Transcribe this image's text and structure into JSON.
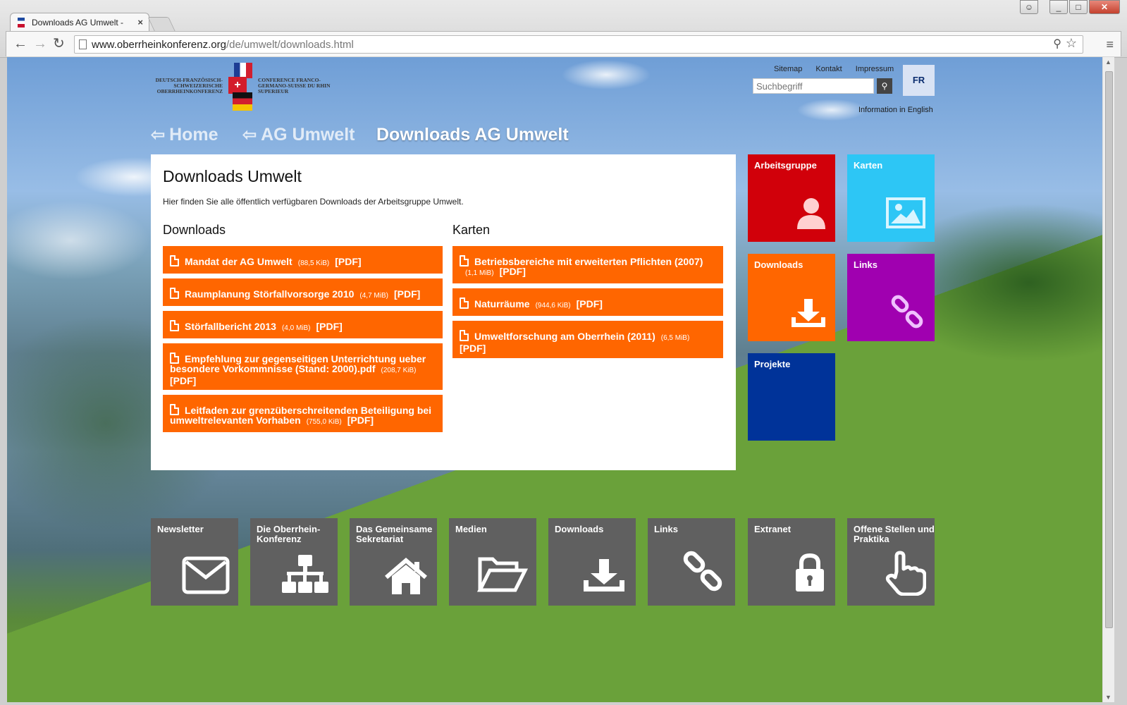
{
  "browser": {
    "tab_title": "Downloads AG Umwelt - ",
    "tab_close": "×",
    "url_host": "www.oberrheinkonferenz.org",
    "url_path": "/de/umwelt/downloads.html"
  },
  "logo": {
    "left_lines": "DEUTSCH-FRANZÖSISCH-SCHWEIZERISCHE OBERRHEINKONFERENZ",
    "right_lines": "CONFERENCE FRANCO-GERMANO-SUISSE DU RHIN SUPERIEUR"
  },
  "header": {
    "links": [
      "Sitemap",
      "Kontakt",
      "Impressum"
    ],
    "search_placeholder": "Suchbegriff",
    "lang": "FR",
    "info_english": "Information in English"
  },
  "breadcrumb": {
    "home": "Home",
    "parent": "AG Umwelt",
    "current": "Downloads AG Umwelt"
  },
  "content": {
    "title": "Downloads Umwelt",
    "intro": "Hier finden Sie alle öffentlich verfügbaren Downloads der Arbeitsgruppe Umwelt.",
    "downloads_heading": "Downloads",
    "karten_heading": "Karten",
    "downloads": [
      {
        "title": "Mandat der AG Umwelt",
        "size": "(88,5 KiB)",
        "type": "[PDF]"
      },
      {
        "title": "Raumplanung Störfallvorsorge 2010",
        "size": "(4,7 MiB)",
        "type": "[PDF]"
      },
      {
        "title": "Störfallbericht 2013",
        "size": "(4,0 MiB)",
        "type": "[PDF]"
      },
      {
        "title": "Empfehlung zur gegenseitigen Unterrichtung ueber besondere Vorkommnisse (Stand: 2000).pdf",
        "size": "(208,7 KiB)",
        "type": "[PDF]"
      },
      {
        "title": "Leitfaden zur grenzüberschreitenden Beteiligung bei umweltrelevanten Vorhaben",
        "size": "(755,0 KiB)",
        "type": "[PDF]"
      }
    ],
    "karten": [
      {
        "title": "Betriebsbereiche mit erweiterten Pflichten (2007)",
        "size": "(1,1 MiB)",
        "type": "[PDF]"
      },
      {
        "title": "Naturräume",
        "size": "(944,6 KiB)",
        "type": "[PDF]"
      },
      {
        "title": "Umweltforschung am Oberrhein (2011)",
        "size": "(6,5 MiB)",
        "type": "[PDF]"
      }
    ]
  },
  "side_tiles": {
    "arbeitsgruppe": "Arbeitsgruppe",
    "karten": "Karten",
    "downloads": "Downloads",
    "links": "Links",
    "projekte": "Projekte"
  },
  "bottom_tiles": {
    "newsletter": "Newsletter",
    "oberrhein": "Die Oberrhein-Konferenz",
    "sekretariat": "Das Gemeinsame Sekretariat",
    "medien": "Medien",
    "downloads": "Downloads",
    "links": "Links",
    "extranet": "Extranet",
    "stellen": "Offene Stellen und Praktika"
  },
  "colors": {
    "orange": "#ff6600",
    "red": "#d1000a",
    "cyan": "#2dc6f5",
    "purple": "#a000b0",
    "blue": "#003399",
    "gray": "#606060"
  }
}
